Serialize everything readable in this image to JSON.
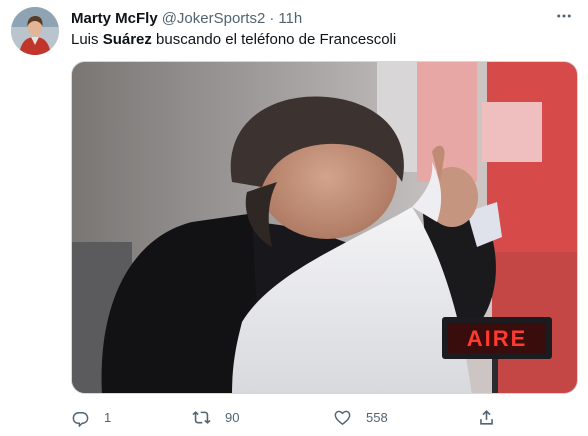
{
  "tweet": {
    "display_name": "Marty McFly",
    "handle": "@JokerSports2",
    "separator": "·",
    "time": "11h",
    "text_before": "Luis ",
    "text_bold": "Suárez",
    "text_after": " buscando el teléfono de Francescoli",
    "media_overlay_text": "AIRE"
  },
  "actions": {
    "reply_count": "1",
    "retweet_count": "90",
    "like_count": "558"
  },
  "icons": {
    "more": "more-dots-icon",
    "reply": "reply-icon",
    "retweet": "retweet-icon",
    "like": "heart-icon",
    "share": "share-icon"
  },
  "colors": {
    "text_primary": "#0f1419",
    "text_secondary": "#536471",
    "border": "#cfd9de"
  }
}
